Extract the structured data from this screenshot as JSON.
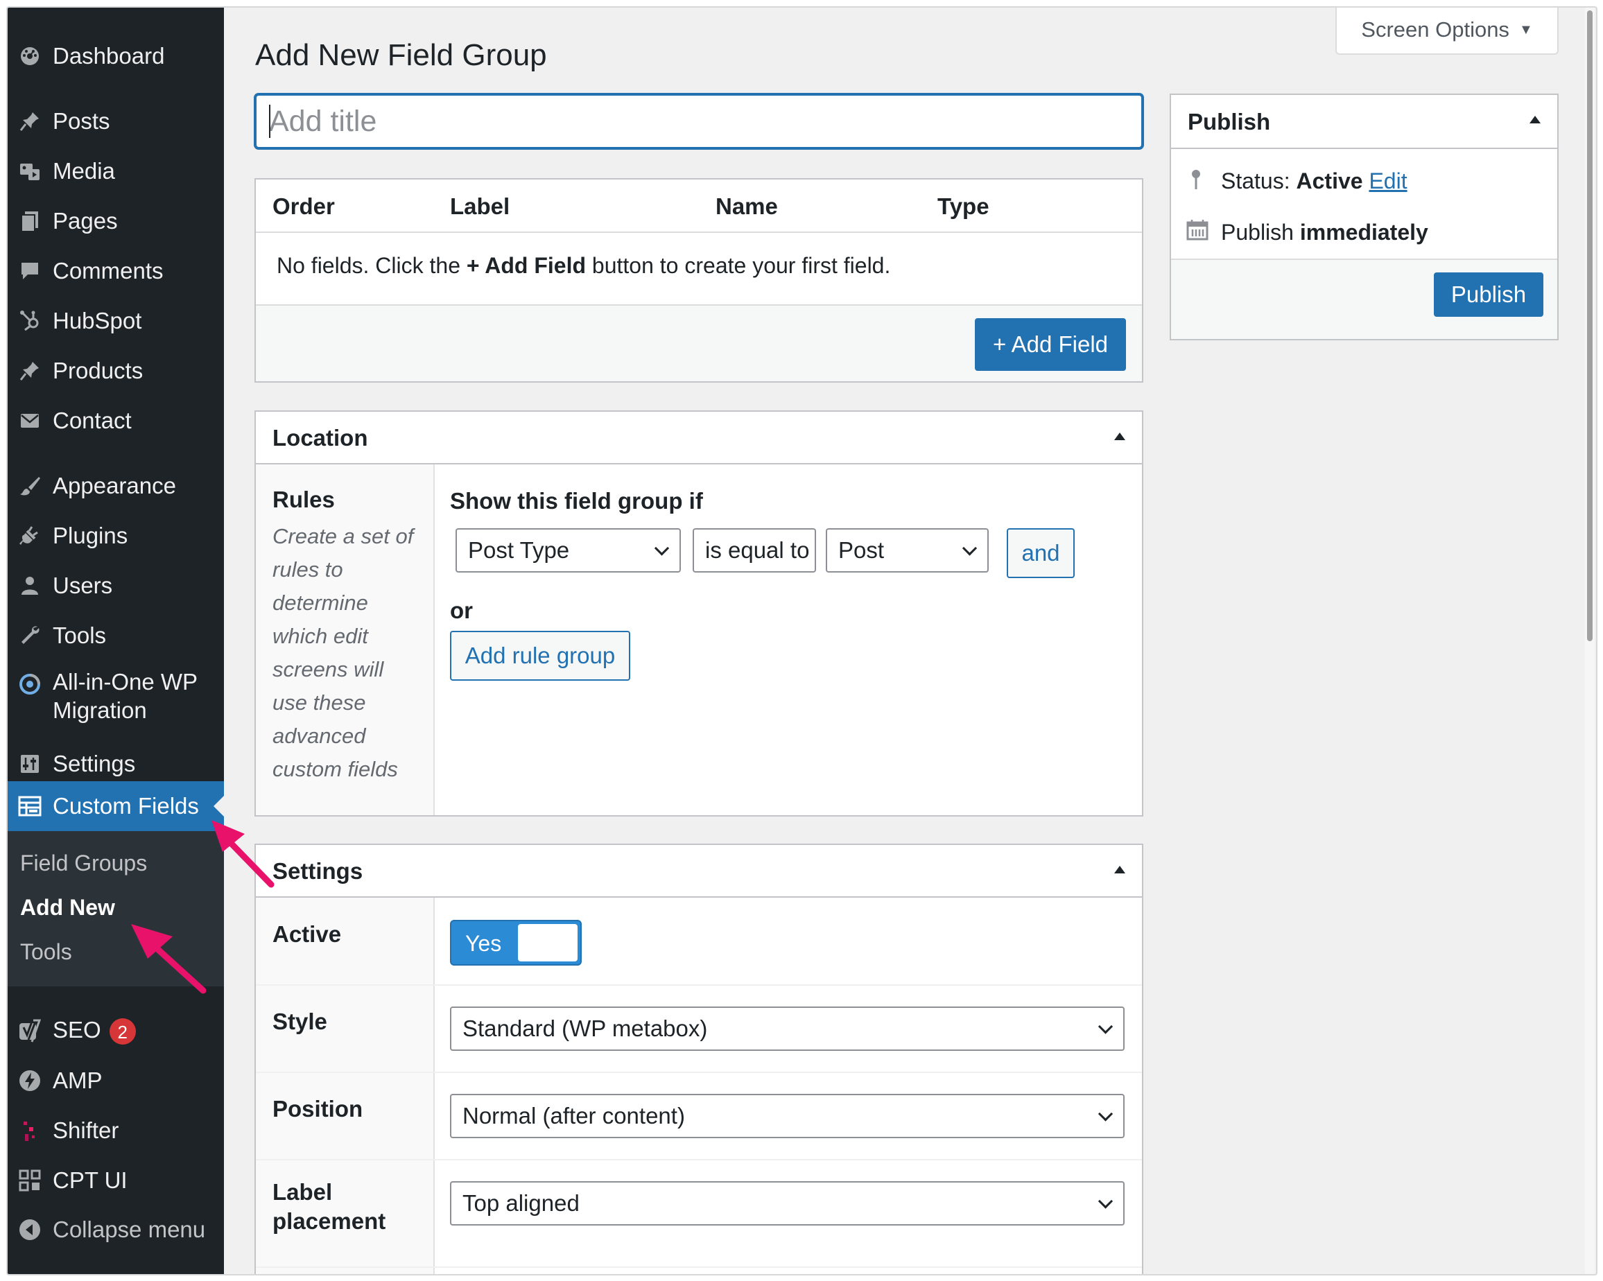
{
  "sidebar": {
    "items": [
      {
        "label": "Dashboard",
        "icon": "dashboard-icon"
      },
      {
        "label": "Posts",
        "icon": "pin-icon"
      },
      {
        "label": "Media",
        "icon": "media-icon"
      },
      {
        "label": "Pages",
        "icon": "pages-icon"
      },
      {
        "label": "Comments",
        "icon": "comment-icon"
      },
      {
        "label": "HubSpot",
        "icon": "hubspot-icon"
      },
      {
        "label": "Products",
        "icon": "pin-icon"
      },
      {
        "label": "Contact",
        "icon": "mail-icon"
      },
      {
        "label": "Appearance",
        "icon": "brush-icon"
      },
      {
        "label": "Plugins",
        "icon": "plugin-icon"
      },
      {
        "label": "Users",
        "icon": "user-icon"
      },
      {
        "label": "Tools",
        "icon": "wrench-icon"
      },
      {
        "label": "All-in-One WP Migration",
        "icon": "migration-icon"
      },
      {
        "label": "Settings",
        "icon": "settings-icon"
      },
      {
        "label": "Custom Fields",
        "icon": "table-icon"
      },
      {
        "label": "SEO",
        "icon": "yoast-icon",
        "badge": "2"
      },
      {
        "label": "AMP",
        "icon": "bolt-icon"
      },
      {
        "label": "Shifter",
        "icon": "shifter-icon"
      },
      {
        "label": "CPT UI",
        "icon": "grid-icon"
      },
      {
        "label": "Collapse menu",
        "icon": "collapse-icon"
      }
    ],
    "submenu": [
      {
        "label": "Field Groups"
      },
      {
        "label": "Add New"
      },
      {
        "label": "Tools"
      }
    ]
  },
  "header": {
    "screen_options": "Screen Options",
    "page_title": "Add New Field Group"
  },
  "title_input": {
    "placeholder": "Add title",
    "value": ""
  },
  "fields_table": {
    "columns": [
      "Order",
      "Label",
      "Name",
      "Type"
    ],
    "empty_prefix": "No fields. Click the ",
    "empty_bold": "+ Add Field",
    "empty_suffix": " button to create your first field.",
    "add_field_button": "+ Add Field"
  },
  "location": {
    "title": "Location",
    "rules_label": "Rules",
    "rules_description": "Create a set of rules to determine which edit screens will use these advanced custom fields",
    "show_if": "Show this field group if",
    "param": "Post Type",
    "operator": "is equal to",
    "value": "Post",
    "and_button": "and",
    "or_label": "or",
    "add_rule_group": "Add rule group"
  },
  "settings": {
    "title": "Settings",
    "active_label": "Active",
    "active_toggle": "Yes",
    "style_label": "Style",
    "style_value": "Standard (WP metabox)",
    "position_label": "Position",
    "position_value": "Normal (after content)",
    "label_placement_label": "Label placement",
    "label_placement_value": "Top aligned"
  },
  "publish": {
    "title": "Publish",
    "status_prefix": "Status: ",
    "status_value": "Active",
    "status_edit": "Edit",
    "publish_prefix": "Publish ",
    "publish_when": "immediately",
    "button": "Publish"
  },
  "colors": {
    "sidebar_bg": "#1d2327",
    "accent": "#2271b1",
    "arrow": "#e8126b"
  }
}
